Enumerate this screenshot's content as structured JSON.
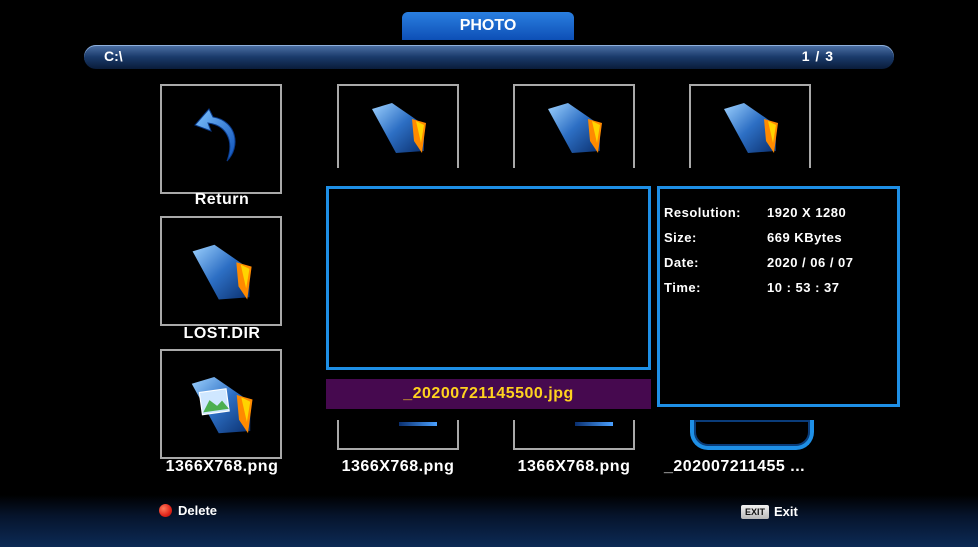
{
  "window": {
    "title": "PHOTO"
  },
  "pathbar": {
    "path": "C:\\",
    "page": "1 / 3"
  },
  "grid": {
    "top_row": [
      {
        "label": "Return",
        "icon": "return-arrow-icon"
      },
      {
        "label": "",
        "icon": "folder-icon"
      },
      {
        "label": "",
        "icon": "folder-icon"
      },
      {
        "label": "",
        "icon": "folder-icon"
      }
    ],
    "left_column": [
      {
        "label": "LOST.DIR",
        "icon": "folder-icon"
      },
      {
        "label": "1366X768.png",
        "icon": "image-folder-icon"
      }
    ],
    "bottom_row": [
      {
        "label": "1366X768.png"
      },
      {
        "label": "1366X768.png"
      },
      {
        "label": "_202007211455 ..."
      }
    ]
  },
  "preview": {
    "filename": "_20200721145500.jpg"
  },
  "info": {
    "resolution_label": "Resolution:",
    "resolution": "1920 X 1280",
    "size_label": "Size:",
    "size": "669 KBytes",
    "date_label": "Date:",
    "date": "2020 / 06 / 07",
    "time_label": "Time:",
    "time": "10 : 53 : 37"
  },
  "legend": {
    "delete_label": "Delete",
    "exit_key": "EXIT",
    "exit_label": "Exit"
  },
  "colors": {
    "accent": "#1e8fe6",
    "filename_bg": "#46094f",
    "filename_text": "#ffd21f"
  }
}
